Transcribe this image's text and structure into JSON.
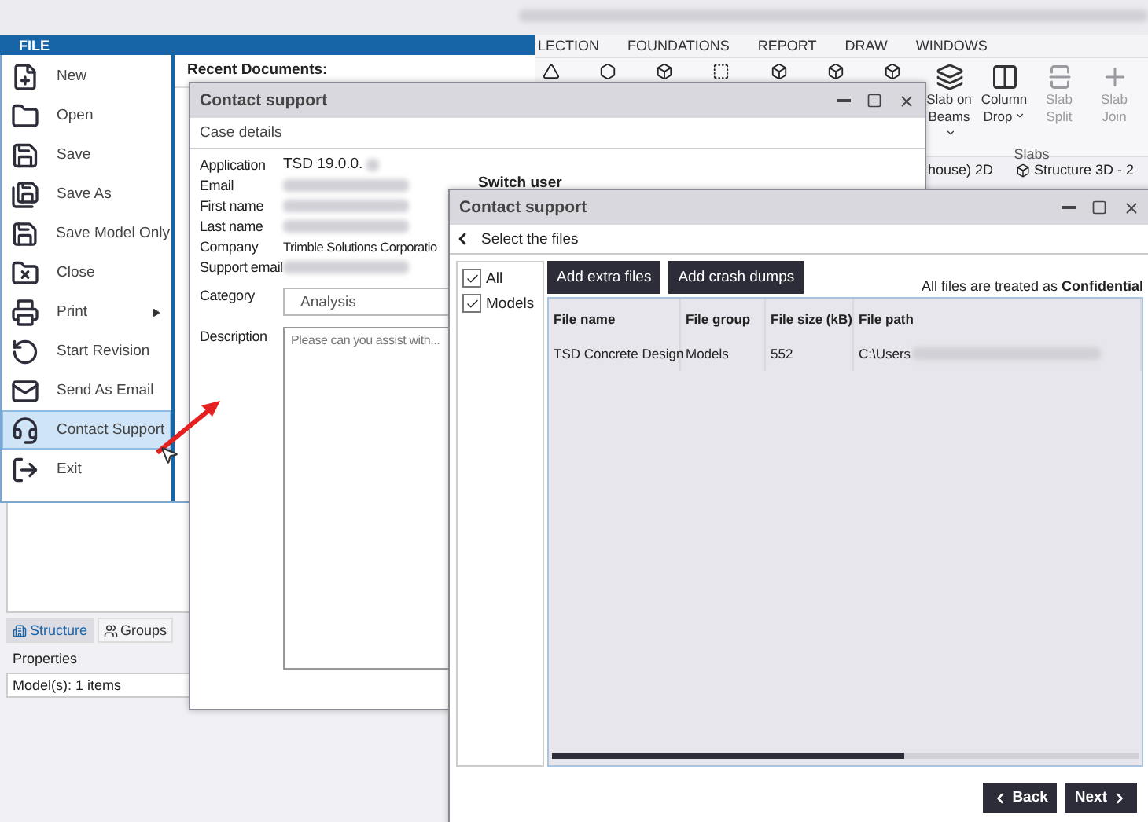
{
  "ribbon": {
    "tabs": [
      {
        "label": "LECTION"
      },
      {
        "label": "FOUNDATIONS"
      },
      {
        "label": "REPORT"
      },
      {
        "label": "DRAW"
      },
      {
        "label": "WINDOWS"
      }
    ],
    "buttons": [
      {
        "label": "Slab on Beams",
        "kind": "slab-beams",
        "dropdown": true,
        "disabled": false
      },
      {
        "label": "Column Drop",
        "kind": "column-drop",
        "dropdown": true,
        "disabled": false
      },
      {
        "label": "Slab Split",
        "kind": "slab-split",
        "dropdown": false,
        "disabled": true
      },
      {
        "label": "Slab Join",
        "kind": "slab-join",
        "dropdown": false,
        "disabled": true
      }
    ],
    "group_label": "Slabs"
  },
  "view_tabs": [
    {
      "label": "house) 2D",
      "kind": "plan"
    },
    {
      "label": "Structure 3D - 2",
      "kind": "model"
    }
  ],
  "side_panel": {
    "tabs": [
      {
        "label": "Structure",
        "kind": "structure",
        "selected": true
      },
      {
        "label": "Groups",
        "kind": "groups",
        "selected": false
      }
    ],
    "properties_title": "Properties",
    "model_field": "Model(s): 1 items"
  },
  "file_menu": {
    "title": "FILE",
    "recent_title": "Recent Documents:",
    "items": [
      {
        "label": "New",
        "kind": "new",
        "submenu": false,
        "selected": false
      },
      {
        "label": "Open",
        "kind": "open",
        "submenu": false,
        "selected": false
      },
      {
        "label": "Save",
        "kind": "save",
        "submenu": false,
        "selected": false
      },
      {
        "label": "Save As",
        "kind": "save-as",
        "submenu": false,
        "selected": false
      },
      {
        "label": "Save Model Only",
        "kind": "save-model",
        "submenu": false,
        "selected": false
      },
      {
        "label": "Close",
        "kind": "close",
        "submenu": false,
        "selected": false
      },
      {
        "label": "Print",
        "kind": "print",
        "submenu": true,
        "selected": false
      },
      {
        "label": "Start Revision",
        "kind": "revision",
        "submenu": false,
        "selected": false
      },
      {
        "label": "Send As Email",
        "kind": "email",
        "submenu": false,
        "selected": false
      },
      {
        "label": "Contact Support",
        "kind": "support",
        "submenu": false,
        "selected": true
      },
      {
        "label": "Exit",
        "kind": "exit",
        "submenu": false,
        "selected": false
      }
    ]
  },
  "case_dialog": {
    "title": "Contact support",
    "section": "Case details",
    "switch_user": "Switch user",
    "fields": [
      {
        "label": "Application",
        "value": "TSD 19.0.0.",
        "redacted": true
      },
      {
        "label": "Email",
        "redacted": true
      },
      {
        "label": "First name",
        "redacted": true
      },
      {
        "label": "Last name",
        "redacted": true
      },
      {
        "label": "Company",
        "value": "Trimble Solutions Corporatio",
        "redacted": false
      },
      {
        "label": "Support email",
        "redacted": true
      }
    ],
    "category": {
      "label": "Category",
      "value": "Analysis"
    },
    "description": {
      "label": "Description",
      "placeholder": "Please can you assist with..."
    }
  },
  "files_dialog": {
    "title": "Contact support",
    "step": "Select the files",
    "filters": [
      {
        "label": "All",
        "checked": true
      },
      {
        "label": "Models",
        "checked": true
      }
    ],
    "actions": [
      "Add extra files",
      "Add crash dumps"
    ],
    "notice": "All files are treated as **Confidential**",
    "table": {
      "columns": [
        "File name",
        "File group",
        "File size (kB)",
        "File path"
      ],
      "rows": [
        {
          "cells": [
            "TSD Concrete Design",
            "Models",
            "552",
            "C:\\Users"
          ],
          "path_redacted": true
        }
      ]
    },
    "buttons": [
      {
        "label": "Back",
        "kind": "back"
      },
      {
        "label": "Next",
        "kind": "next"
      }
    ]
  }
}
